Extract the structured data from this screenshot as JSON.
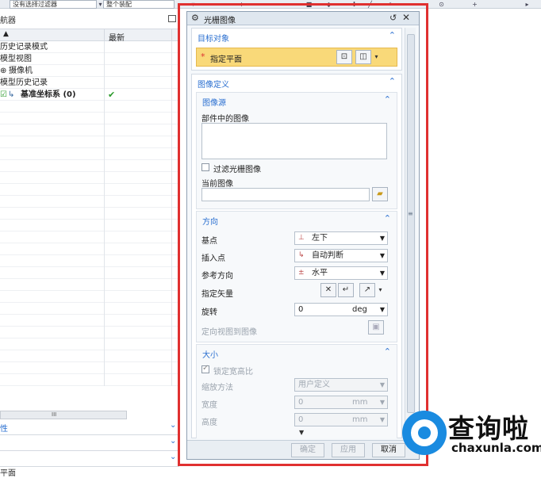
{
  "toolbar": {
    "filter_combo": "没有选择过滤器",
    "assembly_combo": "整个装配"
  },
  "navigator": {
    "title": "航器",
    "col_latest": "最新",
    "rows": [
      {
        "label": "历史记录模式"
      },
      {
        "label": "模型视图"
      },
      {
        "label": "摄像机"
      },
      {
        "label": "模型历史记录"
      },
      {
        "label": "基准坐标系 (0)",
        "check": "✔"
      }
    ],
    "scroll_grip": "III",
    "panels": [
      "性",
      "",
      ""
    ],
    "status_text": "平面"
  },
  "dialog": {
    "title": "光栅图像",
    "target": {
      "header": "目标对象",
      "required_mark": "*",
      "specify_plane": "指定平面"
    },
    "image_def": {
      "header": "图像定义",
      "source": {
        "header": "图像源",
        "part_image_label": "部件中的图像",
        "filter_checkbox_label": "过滤光栅图像",
        "current_image_label": "当前图像"
      },
      "orientation": {
        "header": "方向",
        "base_point_label": "基点",
        "base_point_value": "左下",
        "insert_point_label": "插入点",
        "insert_point_value": "自动判断",
        "ref_direction_label": "参考方向",
        "ref_direction_value": "水平",
        "vector_label": "指定矢量",
        "rotation_label": "旋转",
        "rotation_value": "0",
        "rotation_unit": "deg",
        "orient_view_label": "定向视图到图像"
      },
      "size": {
        "header": "大小",
        "lock_ratio_label": "锁定宽高比",
        "scale_method_label": "缩放方法",
        "scale_method_value": "用户定义",
        "width_label": "宽度",
        "width_value": "0",
        "width_unit": "mm",
        "height_label": "高度",
        "height_value": "0",
        "height_unit": "mm"
      }
    },
    "footer": {
      "ok": "确定",
      "apply": "应用",
      "cancel": "取消"
    }
  },
  "brand": {
    "cn": "查询啦",
    "en": "chaxunla.com"
  },
  "colors": {
    "accent": "#2a6fd0",
    "highlight_border": "#e03030",
    "selection_bg": "#f9d979",
    "brand_blue": "#1a8be0"
  }
}
